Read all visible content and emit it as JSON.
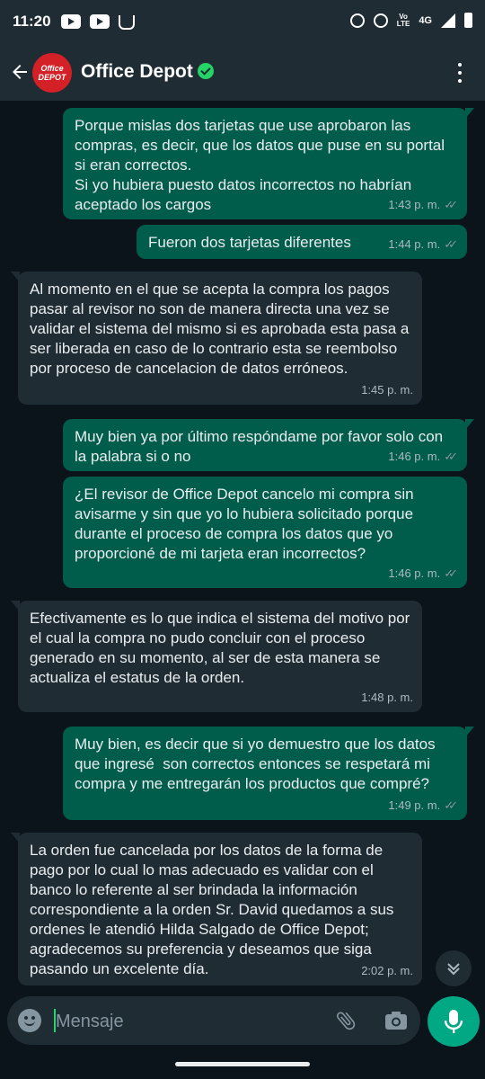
{
  "status_bar": {
    "time": "11:20",
    "network": "4G",
    "volte_line1": "Vo",
    "volte_line2": "LTE"
  },
  "header": {
    "contact_name": "Office Depot",
    "avatar_line1": "Office",
    "avatar_line2": "DEPOT",
    "verified": true
  },
  "messages": [
    {
      "direction": "out",
      "text": "Porque mislas dos tarjetas que use aprobaron las compras, es decir, que los datos que puse en su portal si eran correctos.\nSi yo hubiera puesto datos incorrectos no habrían aceptado los cargos",
      "time": "1:43 p. m.",
      "read": true
    },
    {
      "direction": "out",
      "text": "Fueron dos tarjetas diferentes",
      "time": "1:44 p. m.",
      "read": true
    },
    {
      "direction": "in",
      "text": "Al momento en el que se acepta la compra los pagos pasar al revisor no son de manera directa una vez se validar el sistema del mismo si es aprobada esta pasa a ser liberada en caso de lo contrario esta se reembolso por proceso de cancelacion de datos erróneos.",
      "time": "1:45 p. m."
    },
    {
      "direction": "out",
      "text": "Muy bien ya por último respóndame por favor solo con la palabra si o no",
      "time": "1:46 p. m.",
      "read": true
    },
    {
      "direction": "out",
      "text": "¿El revisor de Office Depot cancelo mi compra sin avisarme y sin que yo lo hubiera solicitado porque durante el proceso de compra los datos que yo proporcioné de mi tarjeta eran incorrectos?",
      "time": "1:46 p. m.",
      "read": true
    },
    {
      "direction": "in",
      "text": "Efectivamente es lo que indica el sistema del motivo por el cual la compra no pudo concluir con el proceso generado en su momento, al ser de esta manera se actualiza el estatus de la orden.",
      "time": "1:48 p. m."
    },
    {
      "direction": "out",
      "text": "Muy bien, es decir que si yo demuestro que los datos que ingresé  son correctos entonces se respetará mi compra y me entregarán los productos que compré?",
      "time": "1:49 p. m.",
      "read": true
    },
    {
      "direction": "in",
      "text": "La orden fue cancelada por los datos de la forma de pago por lo cual lo mas adecuado es validar con el banco lo referente al ser brindada la información correspondiente a la orden Sr. David quedamos a sus ordenes le atendió Hilda Salgado de Office Depot; agradecemos su preferencia y deseamos que siga pasando un excelente día.",
      "time": "2:02 p. m."
    }
  ],
  "composer": {
    "placeholder": "Mensaje"
  },
  "colors": {
    "background": "#0b141a",
    "outgoing_bubble": "#005c4b",
    "incoming_bubble": "#1f2c34",
    "accent": "#00a884",
    "verified": "#25d366"
  },
  "icons": [
    "youtube-icon",
    "shopping-bag-icon",
    "alarm-icon",
    "data-saver-icon",
    "signal-icon",
    "battery-icon",
    "back-arrow-icon",
    "verified-icon",
    "more-options-icon",
    "scroll-down-icon",
    "emoji-icon",
    "attach-icon",
    "camera-icon",
    "mic-icon"
  ]
}
